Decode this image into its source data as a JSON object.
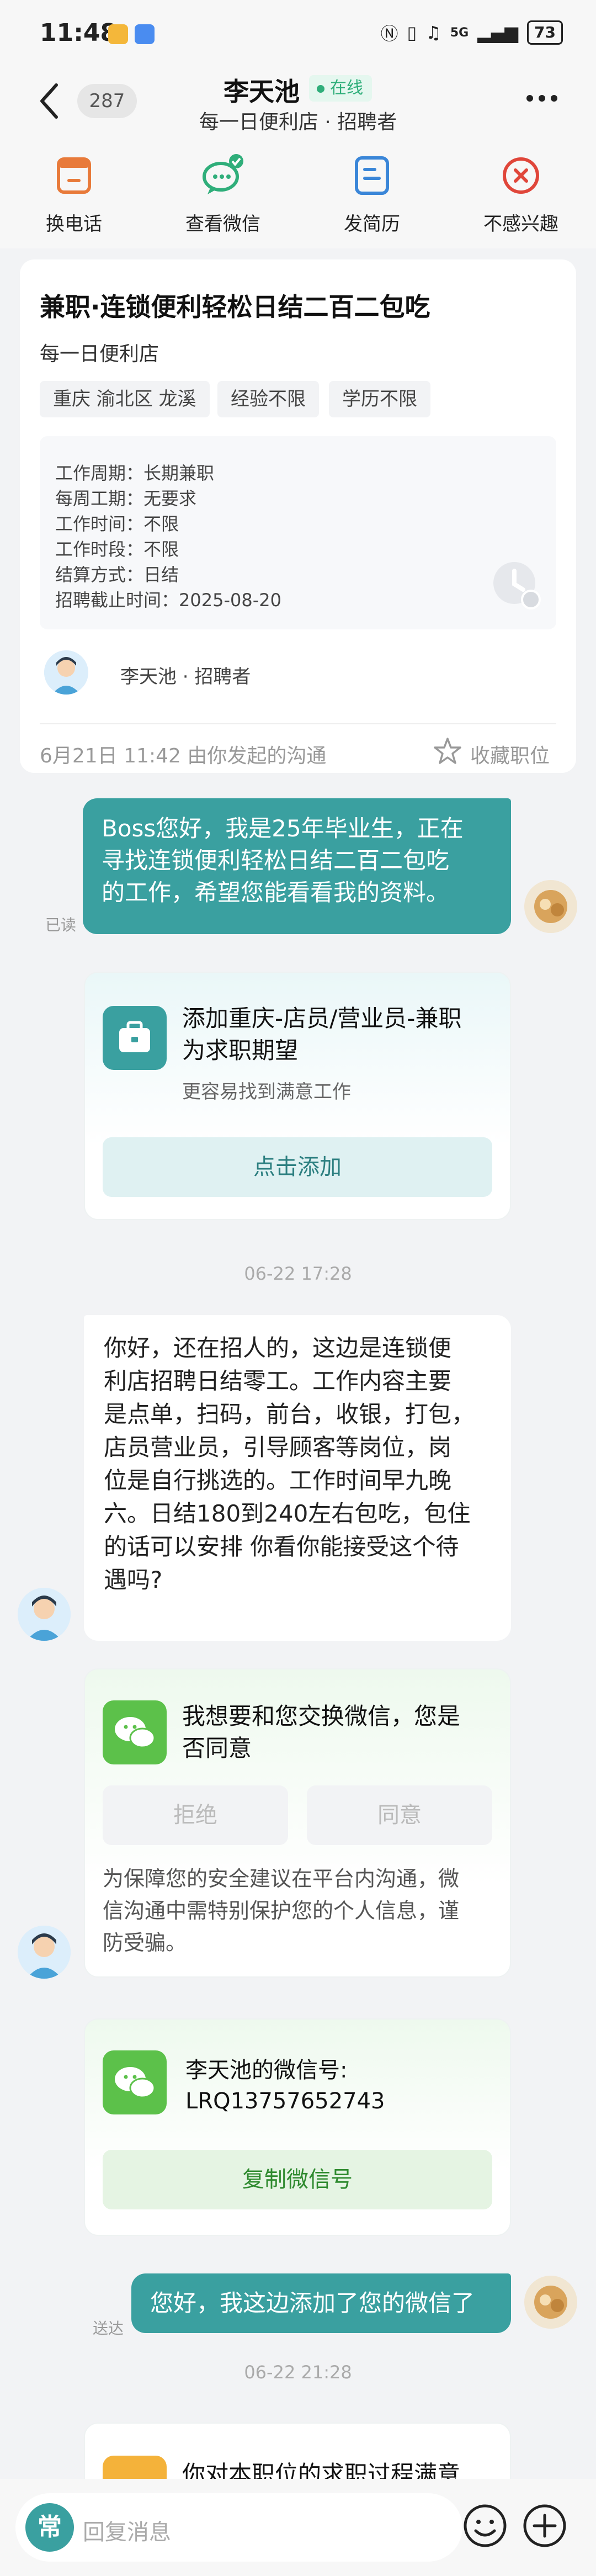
{
  "status": {
    "time": "11:48",
    "signal": "5G",
    "battery": "73"
  },
  "header": {
    "unread_count": "287",
    "name": "李天池",
    "online": "在线",
    "subtitle": "每一日便利店 · 招聘者"
  },
  "actions": [
    {
      "label": "换电话",
      "icon": "phone-swap-icon"
    },
    {
      "label": "查看微信",
      "icon": "wechat-view-icon"
    },
    {
      "label": "发简历",
      "icon": "resume-send-icon"
    },
    {
      "label": "不感兴趣",
      "icon": "not-interested-icon"
    }
  ],
  "job": {
    "title": "兼职·连锁便利轻松日结二百二包吃",
    "company": "每一日便利店",
    "tags": [
      "重庆 渝北区 龙溪",
      "经验不限",
      "学历不限"
    ],
    "details": [
      "工作周期：长期兼职",
      "每周工期：无要求",
      "工作时间：不限",
      "工作时段：不限",
      "结算方式：日结",
      "招聘截止时间：2025-08-20"
    ],
    "recruiter": "李天池 · 招聘者",
    "origin": "6月21日 11:42 由你发起的沟通",
    "collect": "收藏职位"
  },
  "chat": {
    "msg1": {
      "lines": [
        "Boss您好，我是25年毕业生，正在",
        "寻找连锁便利轻松日结二百二包吃",
        "的工作，希望您能看看我的资料。"
      ],
      "status": "已读"
    },
    "add_card": {
      "title_lines": [
        "添加重庆-店员/营业员-兼职",
        "为求职期望"
      ],
      "subtitle": "更容易找到满意工作",
      "button": "点击添加"
    },
    "ts1": "06-22 17:28",
    "msg2": {
      "lines": [
        "你好，还在招人的，这边是连锁便",
        "利店招聘日结零工。工作内容主要",
        "是点单，扫码，前台，收银，打包，",
        "店员营业员，引导顾客等岗位，岗",
        "位是自行挑选的。工作时间早九晚",
        "六。日结180到240左右包吃，包住",
        "的话可以安排 你看你能接受这个待",
        "遇吗?"
      ]
    },
    "wx_request": {
      "title_lines": [
        "我想要和您交换微信，您是",
        "否同意"
      ],
      "reject": "拒绝",
      "agree": "同意",
      "notice_lines": [
        "为保障您的安全建议在平台内沟通，微",
        "信沟通中需特别保护您的个人信息，谨",
        "防受骗。"
      ]
    },
    "wx_id_card": {
      "title_line1": "李天池的微信号:",
      "wechat_id": "LRQ13757652743",
      "button": "复制微信号"
    },
    "msg3": {
      "text": "您好，我这边添加了您的微信了",
      "status": "送达"
    },
    "ts2": "06-22 21:28",
    "partial_card": {
      "title": "你对本职位的求职过程满意"
    }
  },
  "input": {
    "mode_label": "常",
    "placeholder": "回复消息"
  },
  "colors": {
    "brand_teal": "#3aa0a0",
    "online_green": "#2fae7a",
    "wechat_green": "#5cc14a",
    "reject_red": "#e0463a"
  }
}
